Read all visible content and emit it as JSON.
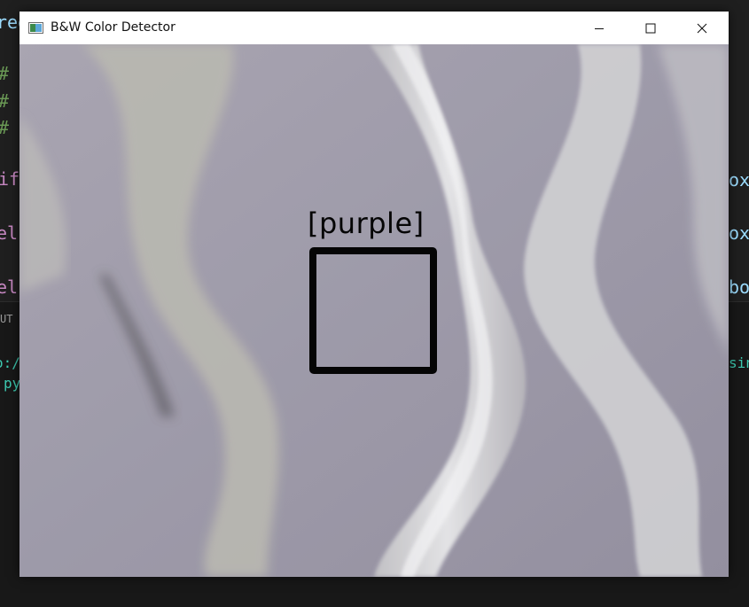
{
  "window": {
    "title": "B&W Color Detector"
  },
  "detection": {
    "label": "[purple]"
  },
  "background_editor": {
    "fragments": [
      {
        "text": "red",
        "color": "#9cdcfe"
      },
      {
        "text": "# l",
        "color": "#6a9955"
      },
      {
        "text": "# g",
        "color": "#6a9955"
      },
      {
        "text": "# w",
        "color": "#6a9955"
      },
      {
        "text": "if",
        "color": "#c586c0"
      },
      {
        "text": "el:",
        "color": "#c586c0"
      },
      {
        "text": "el:",
        "color": "#c586c0"
      },
      {
        "text": "UT",
        "color": "#9a9a9a"
      },
      {
        "text": "o:/",
        "color": "#3dc9b0"
      },
      {
        "text": "py",
        "color": "#3dc9b0"
      },
      {
        "text": "ox",
        "color": "#9cdcfe"
      },
      {
        "text": "ox",
        "color": "#9cdcfe"
      },
      {
        "text": "bo",
        "color": "#9cdcfe"
      },
      {
        "text": "sin",
        "color": "#3dc9b0"
      }
    ]
  },
  "colors": {
    "box": "#050505",
    "titlebar": "#ffffff"
  }
}
